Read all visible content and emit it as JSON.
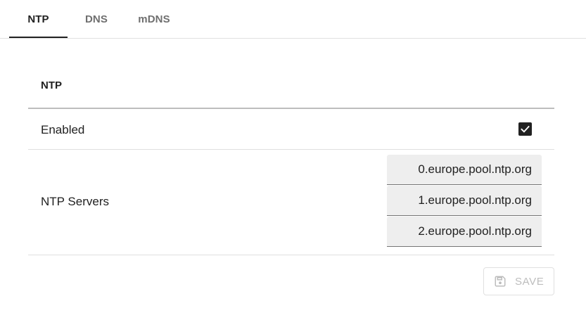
{
  "tabs": [
    {
      "label": "NTP",
      "active": true
    },
    {
      "label": "DNS",
      "active": false
    },
    {
      "label": "mDNS",
      "active": false
    }
  ],
  "section": {
    "title": "NTP"
  },
  "settings": {
    "enabled_label": "Enabled",
    "enabled_checked": true,
    "servers_label": "NTP Servers",
    "servers": [
      "0.europe.pool.ntp.org",
      "1.europe.pool.ntp.org",
      "2.europe.pool.ntp.org"
    ]
  },
  "actions": {
    "save_label": "SAVE",
    "save_icon": "save-icon",
    "save_disabled": true
  },
  "colors": {
    "text": "#212121",
    "inactive_tab": "#6f6f6f",
    "field_background": "#eeeeee",
    "disabled": "#bdbdbd"
  }
}
